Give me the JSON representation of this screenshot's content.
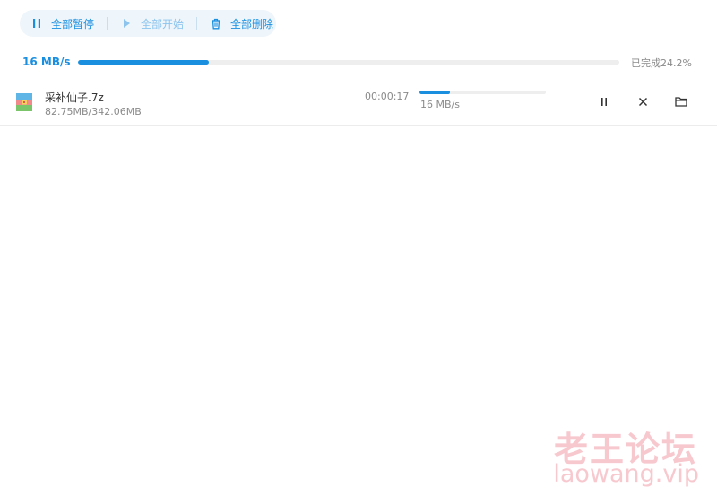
{
  "toolbar": {
    "pause_all": {
      "label": "全部暂停",
      "icon": "pause-icon",
      "enabled": true
    },
    "start_all": {
      "label": "全部开始",
      "icon": "play-icon",
      "enabled": false
    },
    "delete_all": {
      "label": "全部删除",
      "icon": "trash-icon",
      "enabled": true
    }
  },
  "overall": {
    "speed": "16 MB/s",
    "progress": 0.242,
    "status": "已完成24.2%"
  },
  "downloads": [
    {
      "file_name": "采补仙子.7z",
      "file_icon": "archive-file-icon",
      "size_text": "82.75MB/342.06MB",
      "elapsed": "00:00:17",
      "progress": 0.242,
      "speed": "16 MB/s",
      "actions": [
        "pause-icon",
        "close-icon",
        "folder-icon"
      ]
    }
  ],
  "watermark": {
    "title": "老王论坛",
    "url": "laowang.vip"
  },
  "colors": {
    "accent": "#1a8fe0",
    "accent_disabled": "#8cc4ee",
    "toolbar_bg": "#eef5fb",
    "watermark": "#f7c9cf"
  }
}
